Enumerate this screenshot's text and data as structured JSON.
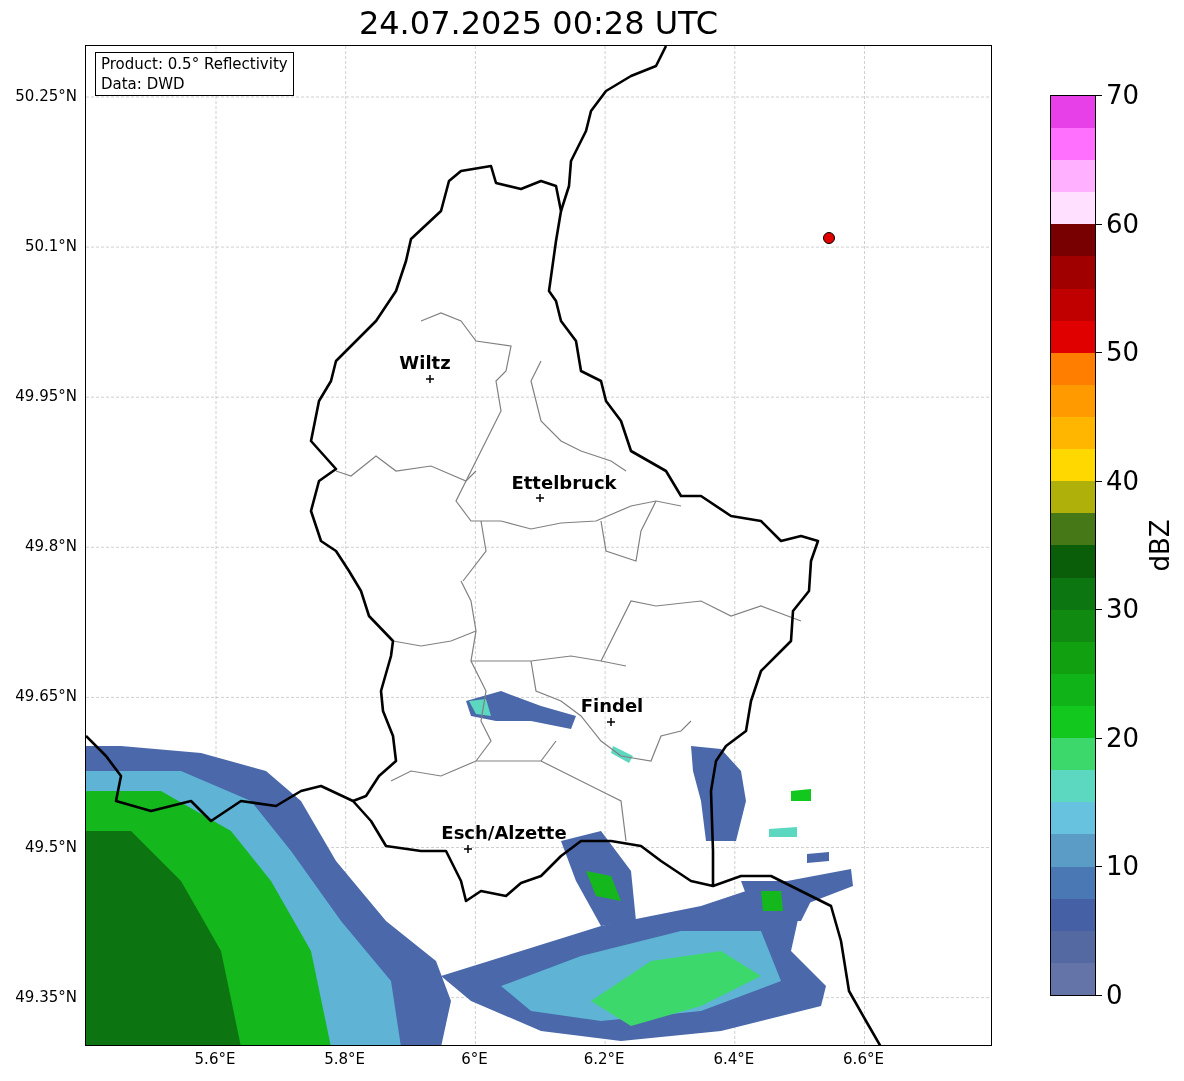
{
  "title": "24.07.2025 00:28 UTC",
  "info_box": [
    "Product: 0.5° Reflectivity",
    "Data: DWD"
  ],
  "y_ticks": [
    "50.25°N",
    "50.1°N",
    "49.95°N",
    "49.8°N",
    "49.65°N",
    "49.5°N",
    "49.35°N"
  ],
  "x_ticks": [
    "5.6°E",
    "5.8°E",
    "6°E",
    "6.2°E",
    "6.4°E",
    "6.6°E"
  ],
  "cities": [
    {
      "name": "Wiltz"
    },
    {
      "name": "Ettelbruck"
    },
    {
      "name": "Findel"
    },
    {
      "name": "Esch/Alzette"
    }
  ],
  "colorbar": {
    "label": "dBZ",
    "ticks": [
      "70",
      "60",
      "50",
      "40",
      "30",
      "20",
      "10",
      "0"
    ],
    "bins": [
      {
        "color": "#6474a8"
      },
      {
        "color": "#5468a2"
      },
      {
        "color": "#4660a6"
      },
      {
        "color": "#4a78b4"
      },
      {
        "color": "#5a9cc6"
      },
      {
        "color": "#66c2de"
      },
      {
        "color": "#5cd8c0"
      },
      {
        "color": "#3cd86c"
      },
      {
        "color": "#12c81e"
      },
      {
        "color": "#10b418"
      },
      {
        "color": "#10a010"
      },
      {
        "color": "#108a10"
      },
      {
        "color": "#0c7610"
      },
      {
        "color": "#0a5e0a"
      },
      {
        "color": "#467818"
      },
      {
        "color": "#b0b00a"
      },
      {
        "color": "#ffd800"
      },
      {
        "color": "#ffb600"
      },
      {
        "color": "#ff9a00"
      },
      {
        "color": "#ff7e00"
      },
      {
        "color": "#e00000"
      },
      {
        "color": "#c00000"
      },
      {
        "color": "#a00000"
      },
      {
        "color": "#780000"
      },
      {
        "color": "#ffe0ff"
      },
      {
        "color": "#ffb0ff"
      },
      {
        "color": "#ff70ff"
      },
      {
        "color": "#e840e8"
      }
    ]
  }
}
